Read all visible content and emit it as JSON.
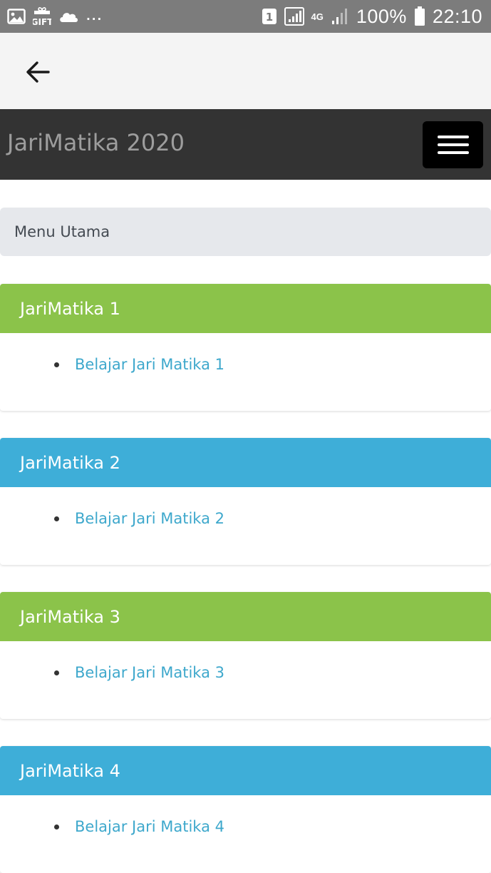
{
  "status_bar": {
    "icons_left": [
      "image-icon",
      "gift-icon",
      "cloud-icon"
    ],
    "more_indicator": "...",
    "sim_label": "1",
    "network_label": "4G",
    "battery_percent": "100%",
    "time": "22:10"
  },
  "app_bar": {
    "back_icon": "arrow-left-icon"
  },
  "navbar": {
    "brand": "JariMatika 2020",
    "menu_icon": "hamburger-menu-icon"
  },
  "breadcrumb": {
    "label": "Menu Utama"
  },
  "panels": [
    {
      "title": "JariMatika 1",
      "link": "Belajar Jari Matika 1",
      "color": "#8bc34a"
    },
    {
      "title": "JariMatika 2",
      "link": "Belajar Jari Matika 2",
      "color": "#3eaed8"
    },
    {
      "title": "JariMatika 3",
      "link": "Belajar Jari Matika 3",
      "color": "#8bc34a"
    },
    {
      "title": "JariMatika 4",
      "link": "Belajar Jari Matika 4",
      "color": "#3eaed8"
    }
  ],
  "colors": {
    "status_bar": "#7c7c7c",
    "app_bar": "#f4f4f4",
    "navbar": "#333333",
    "brand_text": "#9d9d9d",
    "breadcrumb_bg": "#e6e8ec",
    "link": "#3ea8cc"
  }
}
